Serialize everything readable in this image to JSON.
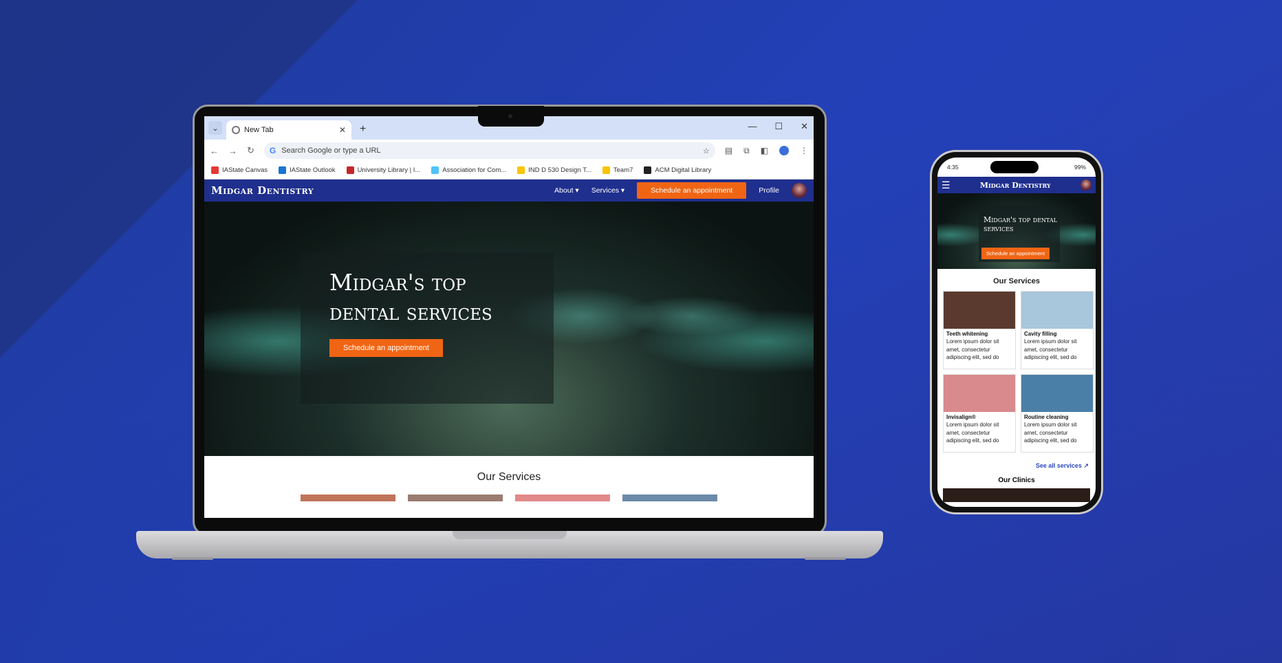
{
  "laptop": {
    "browser": {
      "tab_title": "New Tab",
      "new_tab_symbol": "+",
      "tab_close": "✕",
      "omnibox_placeholder": "Search Google or type a URL",
      "google_letter": "G",
      "bookmarks": [
        {
          "label": "IAState Canvas",
          "color": "#e53935"
        },
        {
          "label": "IAState Outlook",
          "color": "#1976d2"
        },
        {
          "label": "University Library | I...",
          "color": "#c62828"
        },
        {
          "label": "Association for Com...",
          "color": "#4fc3f7"
        },
        {
          "label": "IND D 530 Design T...",
          "color": "#f9c400"
        },
        {
          "label": "Team7",
          "color": "#f9c400"
        },
        {
          "label": "ACM Digital Library",
          "color": "#222222"
        }
      ]
    },
    "site": {
      "logo": "Midgar Dentistry",
      "nav_about": "About ▾",
      "nav_services": "Services ▾",
      "cta": "Schedule an appointment",
      "profile": "Profile",
      "hero_title": "Midgar's top dental services",
      "hero_cta": "Schedule an appointment",
      "services_heading": "Our Services"
    }
  },
  "phone": {
    "time": "4:35",
    "battery": "99%",
    "logo": "Midgar Dentistry",
    "hero_title": "Midgar's top dental services",
    "hero_cta": "Schedule an appointment",
    "services_heading": "Our Services",
    "cards": [
      {
        "title": "Teeth whitening",
        "desc": "Lorem ipsum dolor sit amet, consectetur adipiscing elit, sed do",
        "img": "#5a3a2e"
      },
      {
        "title": "Cavity filling",
        "desc": "Lorem ipsum dolor sit amet, consectetur adipiscing elit, sed do",
        "img": "#a8c6dc"
      },
      {
        "title": "Invisalign®",
        "desc": "Lorem ipsum dolor sit amet, consectetur adipiscing elit, sed do",
        "img": "#d88a8c"
      },
      {
        "title": "Routine cleaning",
        "desc": "Lorem ipsum dolor sit amet, consectetur adipiscing elit, sed do",
        "img": "#4a7fa8"
      }
    ],
    "see_all": "See all services ↗",
    "clinics_heading": "Our Clinics"
  },
  "colors": {
    "nav": "#1f2f8e",
    "accent": "#f06514",
    "link": "#2d48c0"
  }
}
